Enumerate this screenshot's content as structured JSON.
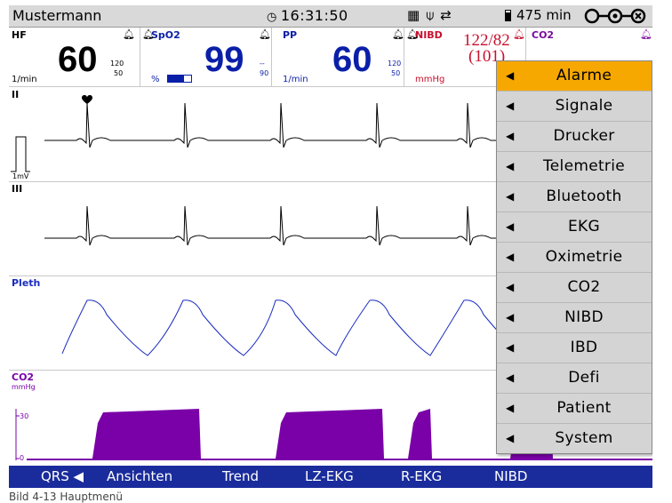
{
  "status": {
    "patient_name": "Mustermann",
    "time": "16:31:50",
    "battery_time": "475 min"
  },
  "params": {
    "hf": {
      "label": "HF",
      "value": "60",
      "unit": "1/min",
      "limit_high": "120",
      "limit_low": "50",
      "color": "#000000"
    },
    "spo2": {
      "label": "SpO2",
      "value": "99",
      "unit": "%",
      "limit_high": "--",
      "limit_low": "90",
      "color": "#0a1fa8"
    },
    "pp": {
      "label": "PP",
      "value": "60",
      "unit": "1/min",
      "limit_high": "120",
      "limit_low": "50",
      "color": "#0a1fa8"
    },
    "nibd": {
      "label": "NIBD",
      "value": "122/82",
      "mean": "(101)",
      "unit": "mmHg",
      "color": "#c8102e"
    },
    "co2": {
      "label": "CO2",
      "color": "#7a0a9a"
    }
  },
  "waves": {
    "ecg2_label": "II",
    "ecg3_label": "III",
    "cal_label": "1mV",
    "pleth_label": "Pleth",
    "co2_label": "CO2",
    "co2_unit": "mmHg",
    "co2_scale_high": "30",
    "co2_scale_low": "0"
  },
  "colors": {
    "ecg": "#000000",
    "pleth": "#1a2cbf",
    "co2": "#7a00a8",
    "menu_active": "#f7a800",
    "softkey_bar": "#1a2c9c"
  },
  "menu": {
    "items": [
      {
        "label": "Alarme",
        "active": true
      },
      {
        "label": "Signale"
      },
      {
        "label": "Drucker"
      },
      {
        "label": "Telemetrie"
      },
      {
        "label": "Bluetooth"
      },
      {
        "label": "EKG"
      },
      {
        "label": "Oximetrie"
      },
      {
        "label": "CO2"
      },
      {
        "label": "NIBD"
      },
      {
        "label": "IBD"
      },
      {
        "label": "Defi"
      },
      {
        "label": "Patient"
      },
      {
        "label": "System"
      }
    ]
  },
  "softkeys": {
    "qrs": "QRS",
    "ansichten": "Ansichten",
    "trend": "Trend",
    "lz_ekg": "LZ-EKG",
    "r_ekg": "R-EKG",
    "nibd": "NIBD"
  },
  "caption": "Bild 4-13 Hauptmenü"
}
